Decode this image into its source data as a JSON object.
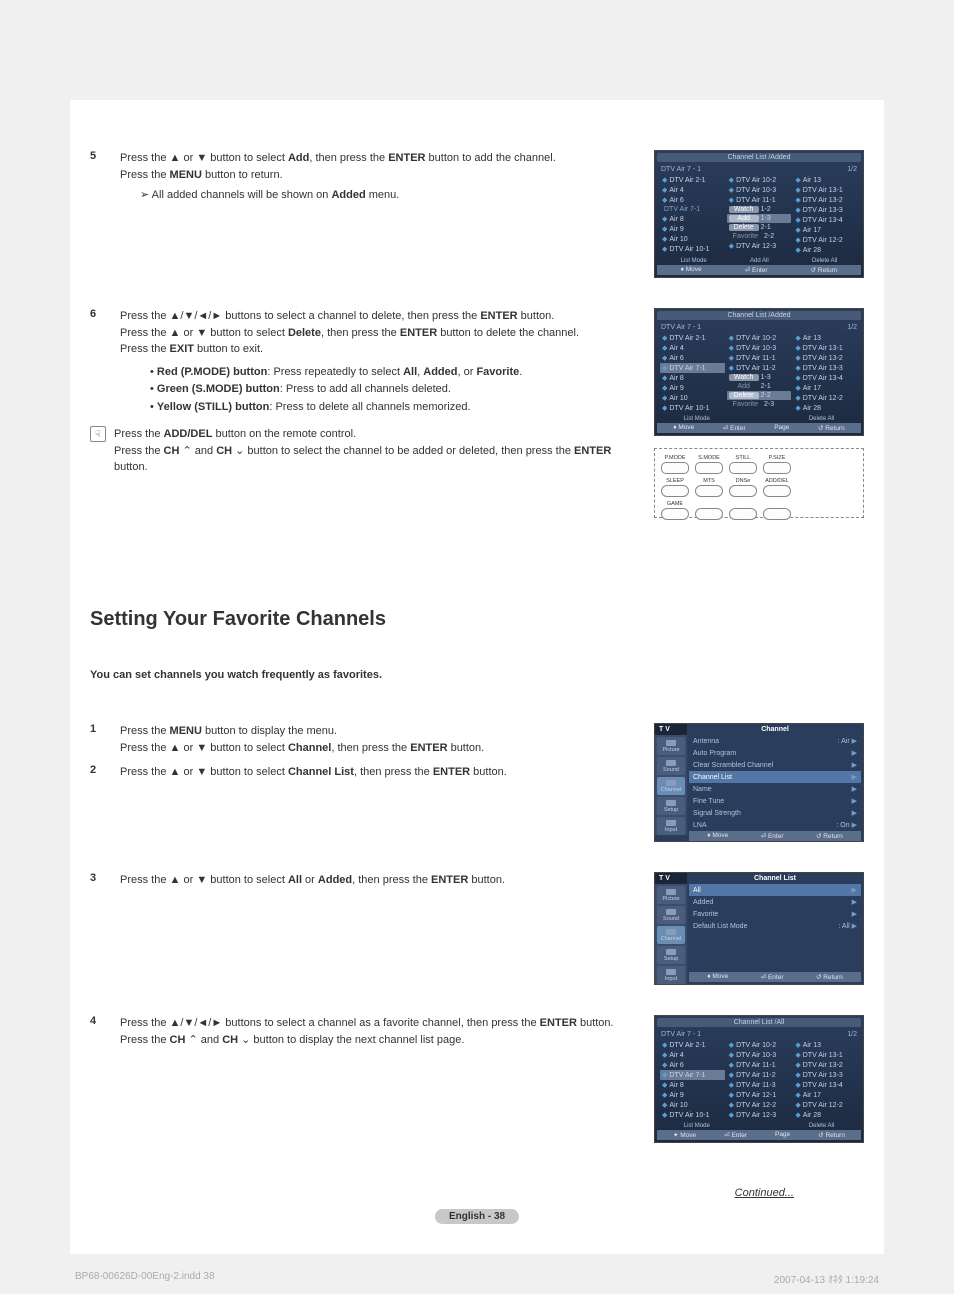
{
  "section1": {
    "step5": {
      "num": "5",
      "text_pre": "Press the ",
      "up": "▲",
      "or": " or ",
      "down": "▼",
      "text_mid": " button to select ",
      "add": "Add",
      "text_mid2": ", then press the ",
      "enter": "ENTER",
      "text_end": " button to add the channel.",
      "line2_pre": "Press the ",
      "menu": "MENU",
      "line2_end": " button to return.",
      "tip_arrow": "➢",
      "tip_text_pre": "All added channels will be shown on ",
      "tip_added": "Added",
      "tip_text_end": " menu."
    },
    "step6": {
      "num": "6",
      "l1_pre": "Press the ",
      "arrows": "▲/▼/◄/►",
      "l1_mid": " buttons to select a channel to delete, then press the ",
      "enter": "ENTER",
      "l1_end": " button.",
      "l2_pre": "Press the ",
      "up": "▲",
      "or": " or ",
      "down": "▼",
      "l2_mid": " button to select ",
      "delete": "Delete",
      "l2_mid2": ", then press the ",
      "l2_end": " button to delete the channel.",
      "l3_pre": "Press the ",
      "exit": "EXIT",
      "l3_end": " button to exit.",
      "bullet1_pre": "• ",
      "bullet1_label": "Red (P.MODE) button",
      "bullet1_mid": ": Press repeatedly to select ",
      "bullet1_all": "All",
      "bullet1_c1": ", ",
      "bullet1_added": "Added",
      "bullet1_c2": ", or ",
      "bullet1_fav": "Favorite",
      "bullet1_end": ".",
      "bullet2_pre": "• ",
      "bullet2_label": "Green (S.MODE) button",
      "bullet2_end": ": Press to add all channels deleted.",
      "bullet3_pre": "• ",
      "bullet3_label": "Yellow (STILL) button",
      "bullet3_end": ": Press to delete all channels memorized."
    },
    "tip": {
      "icon": "☟",
      "l1_pre": "Press the ",
      "adddel": "ADD/DEL",
      "l1_end": " button on the remote control.",
      "l2_pre": "Press the ",
      "chup_label": "CH",
      "chup_icon": " ⌃ ",
      "and": "and ",
      "chdn_label": "CH",
      "chdn_icon": " ⌄ ",
      "l2_mid": "button to select the channel to be added or deleted, then press the ",
      "enter": "ENTER",
      "l2_end": " button."
    }
  },
  "section2": {
    "title": "Setting Your Favorite Channels",
    "subtitle": "You can set channels you watch frequently as favorites.",
    "step1": {
      "num": "1",
      "l1_pre": "Press the ",
      "menu": "MENU",
      "l1_end": " button to display the menu.",
      "l2_pre": "Press the ",
      "up": "▲",
      "or": " or ",
      "down": "▼",
      "l2_mid": " button to select ",
      "channel": "Channel",
      "l2_mid2": ", then press the ",
      "enter": "ENTER",
      "l2_end": " button."
    },
    "step2": {
      "num": "2",
      "pre": "Press the ",
      "up": "▲",
      "or": " or ",
      "down": "▼",
      "mid": " button to select ",
      "cl": "Channel List",
      "mid2": ", then press the ",
      "enter": "ENTER",
      "end": " button."
    },
    "step3": {
      "num": "3",
      "pre": "Press the ",
      "up": "▲",
      "or": " or ",
      "down": "▼",
      "mid": " button to select ",
      "all": "All",
      "or2": " or ",
      "added": "Added",
      "mid2": ", then press the ",
      "enter": "ENTER",
      "end": " button."
    },
    "step4": {
      "num": "4",
      "l1_pre": "Press the ",
      "arrows": "▲/▼/◄/►",
      "l1_mid": " buttons to select a channel as a favorite channel, then press the ",
      "enter": "ENTER",
      "l1_end": " button.",
      "l2_pre": "Press the ",
      "chup_label": "CH",
      "chup_icon": " ⌃ ",
      "and": "and ",
      "chdn_label": "CH",
      "chdn_icon": " ⌄ ",
      "l2_end": "button to display the next channel list page."
    }
  },
  "osd1": {
    "title": "Channel List /Added",
    "channel": "DTV Air 7 - 1",
    "page": "1/2",
    "col1": [
      "DTV Air 2-1",
      "Air 4",
      "Air 6",
      "DTV Air 7-1",
      "Air 8",
      "Air 9",
      "Air 10",
      "DTV Air 10-1"
    ],
    "col2_pre": [
      "DTV Air 10-2",
      "DTV Air 10-3",
      "DTV Air 11-1"
    ],
    "menu": [
      "Watch",
      "Add",
      "Delete",
      "Favorite"
    ],
    "menu_suffix": [
      "1-2",
      "1-3",
      "2-1",
      "2-2"
    ],
    "col2_post": [
      "DTV Air 12-3"
    ],
    "col3": [
      "Air 13",
      "DTV Air 13-1",
      "DTV Air 13-2",
      "DTV Air 13-3",
      "DTV Air 13-4",
      "Air 17",
      "DTV Air 12-2",
      "Air 28"
    ],
    "footer_sub": [
      "List Mode",
      "Add All",
      "Delete All"
    ],
    "footer": [
      "Move",
      "Enter",
      "Return"
    ]
  },
  "osd2": {
    "title": "Channel List /Added",
    "channel": "DTV Air 7 - 1",
    "page": "1/2",
    "col1": [
      "DTV Air 2-1",
      "Air 4",
      "Air 6",
      "DTV Air 7-1",
      "Air 8",
      "Air 9",
      "Air 10",
      "DTV Air 10-1"
    ],
    "col2_pre": [
      "DTV Air 10-2",
      "DTV Air 10-3",
      "DTV Air 11-1",
      "DTV Air 11-2"
    ],
    "menu": [
      "Watch",
      "Add",
      "Delete",
      "Favorite"
    ],
    "menu_suffix": [
      "1-3",
      "2-1",
      "2-2",
      "2-3"
    ],
    "col3": [
      "Air 13",
      "DTV Air 13-1",
      "DTV Air 13-2",
      "DTV Air 13-3",
      "DTV Air 13-4",
      "Air 17",
      "DTV Air 12-2",
      "Air 28"
    ],
    "footer_sub": [
      "List Mode",
      "",
      "Delete All"
    ],
    "footer": [
      "Move",
      "Enter",
      "Page",
      "Return"
    ]
  },
  "remote": {
    "row1": [
      "P.MODE",
      "S.MODE",
      "STILL",
      "P.SIZE"
    ],
    "row2": [
      "SLEEP",
      "MTS",
      "DNSe",
      "ADD/DEL"
    ],
    "row3": [
      "GAME",
      "",
      "",
      ""
    ]
  },
  "osd3": {
    "tv": "T V",
    "side": [
      "Picture",
      "Sound",
      "Channel",
      "Setup",
      "Input"
    ],
    "title": "Channel",
    "items": [
      {
        "label": "Antenna",
        "value": ": Air"
      },
      {
        "label": "Auto Program",
        "value": ""
      },
      {
        "label": "Clear Scrambled Channel",
        "value": ""
      },
      {
        "label": "Channel List",
        "value": "",
        "sel": true
      },
      {
        "label": "Name",
        "value": ""
      },
      {
        "label": "Fine Tune",
        "value": ""
      },
      {
        "label": "Signal Strength",
        "value": ""
      },
      {
        "label": "LNA",
        "value": ": On"
      }
    ],
    "footer": [
      "Move",
      "Enter",
      "Return"
    ]
  },
  "osd4": {
    "tv": "T V",
    "side": [
      "Picture",
      "Sound",
      "Channel",
      "Setup",
      "Input"
    ],
    "title": "Channel List",
    "items": [
      {
        "label": "All",
        "value": "",
        "sel": true
      },
      {
        "label": "Added",
        "value": ""
      },
      {
        "label": "Favorite",
        "value": ""
      },
      {
        "label": "Default List Mode",
        "value": ": All"
      }
    ],
    "footer": [
      "Move",
      "Enter",
      "Return"
    ]
  },
  "osd5": {
    "title": "Channel List /All",
    "channel": "DTV Air 7 - 1",
    "page": "1/2",
    "col1": [
      "DTV Air 2-1",
      "Air 4",
      "Air 6",
      "DTV Air 7-1",
      "Air 8",
      "Air 9",
      "Air 10",
      "DTV Air 10-1"
    ],
    "col2": [
      "DTV Air 10-2",
      "DTV Air 10-3",
      "DTV Air 11-1",
      "DTV Air 11-2",
      "DTV Air 11-3",
      "DTV Air 12-1",
      "DTV Air 12-2",
      "DTV Air 12-3"
    ],
    "col3": [
      "Air 13",
      "DTV Air 13-1",
      "DTV Air 13-2",
      "DTV Air 13-3",
      "DTV Air 13-4",
      "Air 17",
      "DTV Air 12-2",
      "Air 28"
    ],
    "footer_sub": [
      "List Mode",
      "",
      "Delete All"
    ],
    "footer": [
      "Move",
      "Enter",
      "Page",
      "Return"
    ]
  },
  "continued": "Continued...",
  "page_footer": "English - 38",
  "print_left": "BP68-00626D-00Eng-2.indd    38",
  "print_right": "2007-04-13   ｵﾈﾀ 1:19:24"
}
